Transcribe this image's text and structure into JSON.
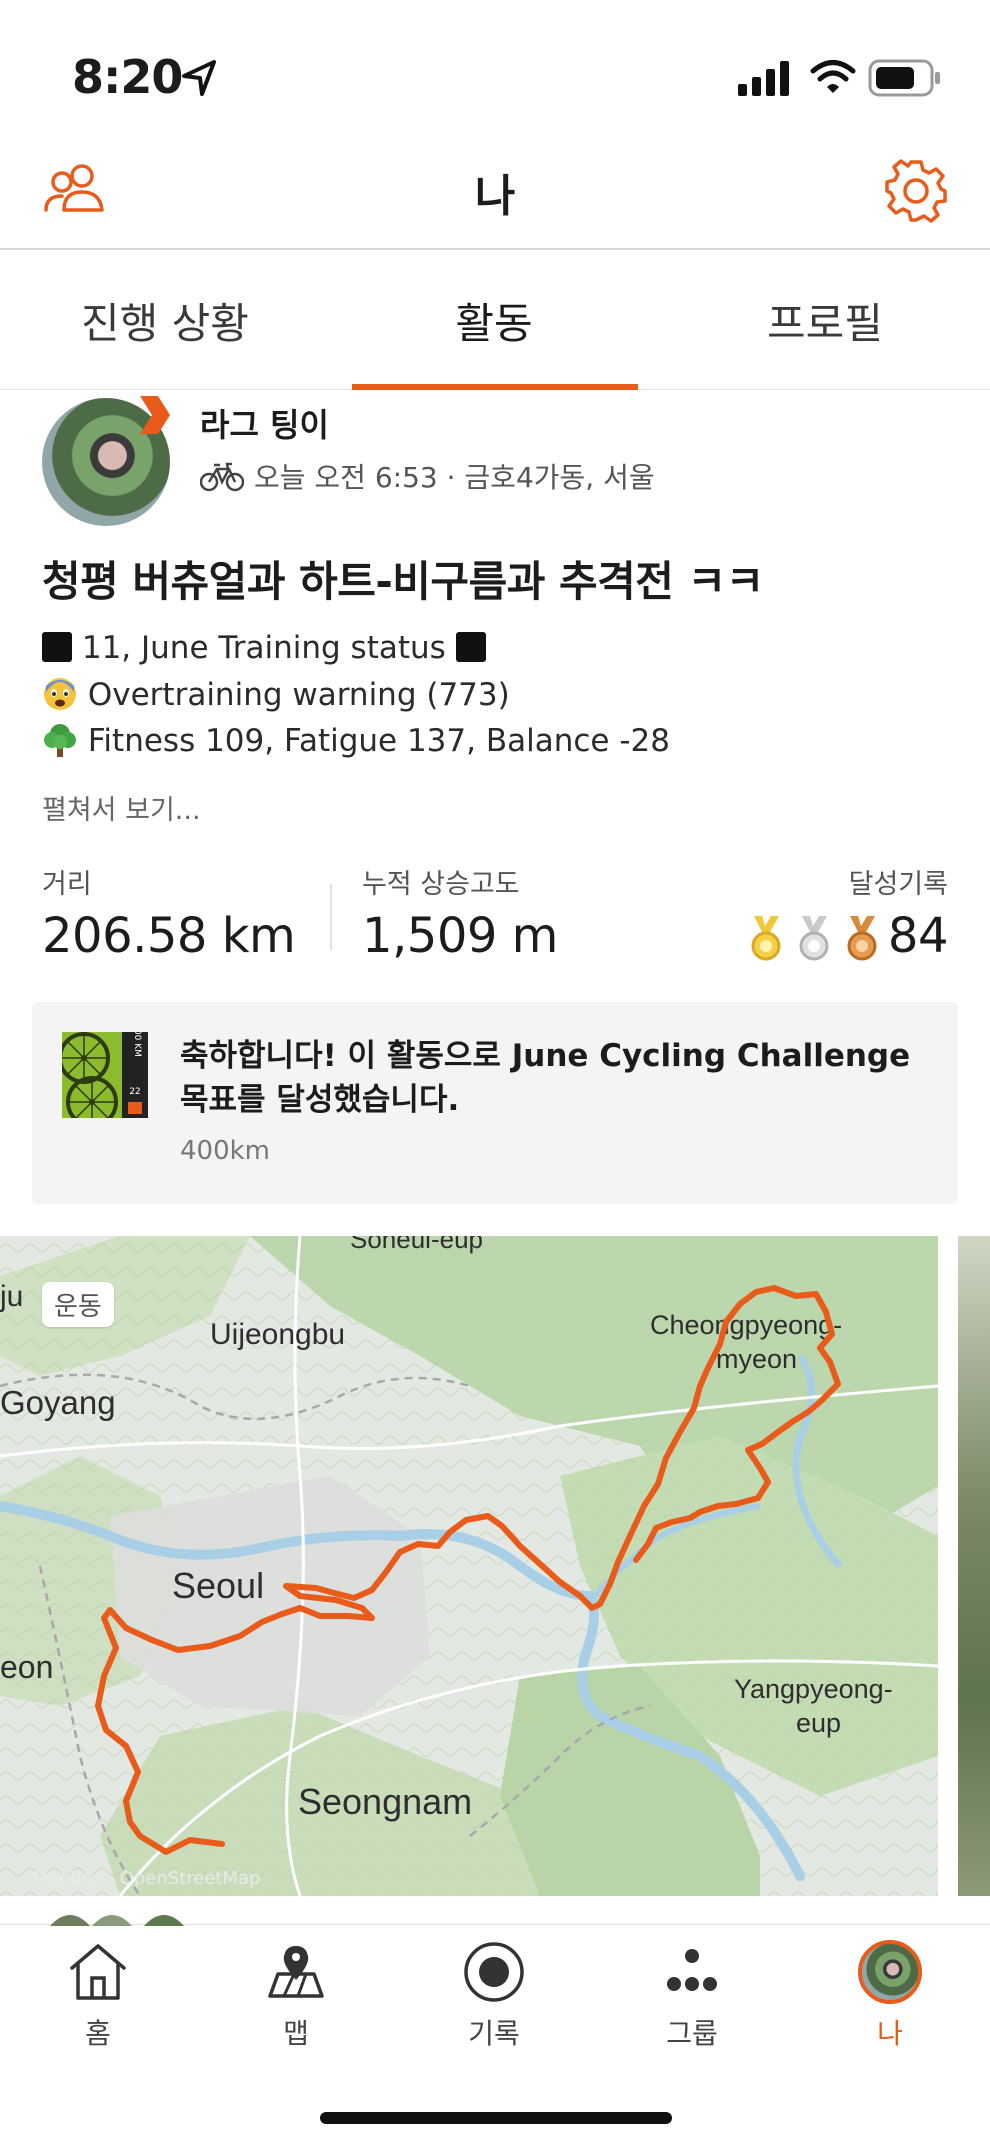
{
  "status_bar": {
    "time": "8:20"
  },
  "header": {
    "title": "나"
  },
  "tabs": [
    {
      "label": "진행 상황"
    },
    {
      "label": "활동"
    },
    {
      "label": "프로필"
    }
  ],
  "activity": {
    "athlete": "라그 팅이",
    "meta": "오늘 오전 6:53 · 금호4가동, 서울",
    "title": "청평 버츄얼과 하트-비구름과 추격전 ㅋㅋ",
    "description": [
      "11, June Training status",
      "Overtraining warning (773)",
      "Fitness 109, Fatigue 137, Balance -28"
    ],
    "see_more": "펼쳐서 보기...",
    "stats": {
      "distance_label": "거리",
      "distance_value": "206.58 km",
      "elevation_label": "누적 상승고도",
      "elevation_value": "1,509 m",
      "achievements_label": "달성기록",
      "achievements_value": "84"
    },
    "challenge": {
      "text_prefix": "축하합니다! 이 활동으로 ",
      "challenge_name": "June Cycling Challenge",
      "text_suffix": "목표를 달성했습니다.",
      "subtitle": "400km",
      "badge_lines": [
        "400 KM",
        "22"
      ]
    }
  },
  "map": {
    "tag": "운동",
    "attribution": "Mapbox · OpenStreetMap",
    "labels": {
      "soheul": "Soheul-eup",
      "uijeongbu": "Uijeongbu",
      "goyang": "Goyang",
      "seoul": "Seoul",
      "seongnam": "Seongnam",
      "yangpyeong": "Yangpyeong-",
      "yangpyeong2": "eup",
      "cheongpyeong": "Cheongpyeong-",
      "cheongpyeong2": "myeon",
      "eon": "eon",
      "ju": "ju"
    },
    "route_color": "#e85b1a"
  },
  "nav": [
    {
      "label": "홈",
      "icon": "home-icon"
    },
    {
      "label": "맵",
      "icon": "map-icon"
    },
    {
      "label": "기록",
      "icon": "record-icon"
    },
    {
      "label": "그룹",
      "icon": "groups-icon"
    },
    {
      "label": "나",
      "icon": "me-avatar"
    }
  ],
  "colors": {
    "accent": "#e85b1a"
  }
}
